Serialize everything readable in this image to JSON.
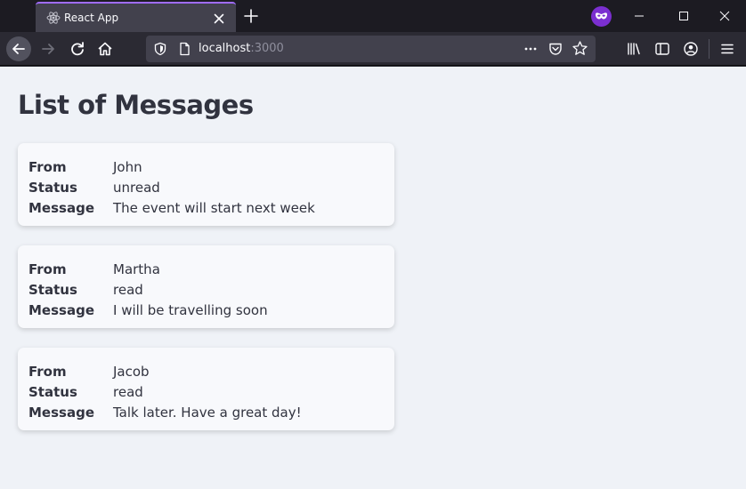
{
  "browser": {
    "tab_title": "React App",
    "url_host": "localhost",
    "url_port": ":3000",
    "private_color": "#7b2fd0",
    "tab_accent": "#a06cff"
  },
  "page": {
    "title": "List of Messages",
    "field_labels": {
      "from": "From",
      "status": "Status",
      "message": "Message"
    },
    "messages": [
      {
        "from": "John",
        "status": "unread",
        "message": "The event will start next week"
      },
      {
        "from": "Martha",
        "status": "read",
        "message": "I will be travelling soon"
      },
      {
        "from": "Jacob",
        "status": "read",
        "message": "Talk later. Have a great day!"
      }
    ]
  }
}
